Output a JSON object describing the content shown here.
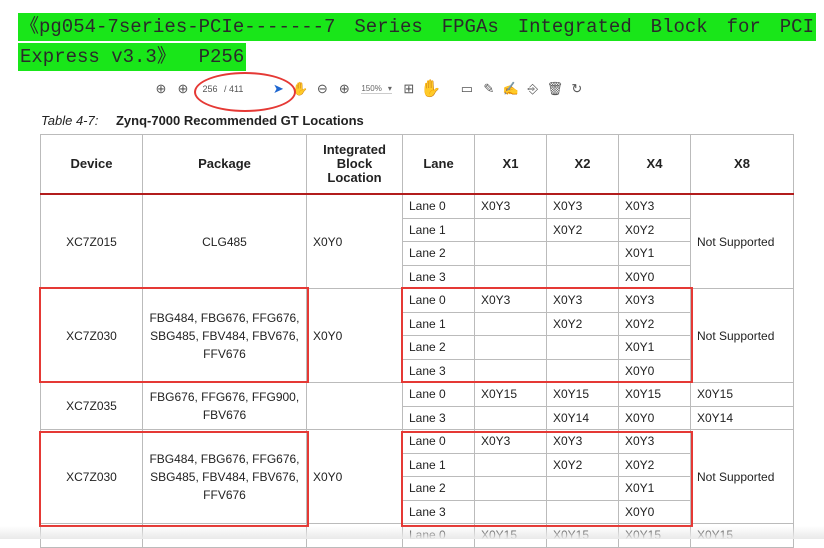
{
  "banner": {
    "line1_words": [
      "《pg054-7series-PCIe-------7",
      "Series",
      "FPGAs",
      "Integrated",
      "Block",
      "for",
      "PCI"
    ],
    "line2": "Express v3.3》  P256"
  },
  "toolbar": {
    "page_current": "256",
    "page_total": "/ 411",
    "zoom": "150%",
    "icons": [
      "up-arrow-icon",
      "down-arrow-icon",
      "cursor-icon",
      "hand-icon",
      "zoom-out-icon",
      "zoom-in-icon",
      "fit-page-icon",
      "hand-tool-icon",
      "comment-icon",
      "pen-icon",
      "sign-icon",
      "stamp-icon",
      "trash-icon",
      "redo-icon"
    ]
  },
  "caption": {
    "number": "Table 4-7:",
    "title": "Zynq-7000 Recommended GT Locations"
  },
  "table": {
    "headers": [
      "Device",
      "Package",
      "Integrated Block Location",
      "Lane",
      "X1",
      "X2",
      "X4",
      "X8"
    ],
    "groups": [
      {
        "device": "XC7Z015",
        "package": "CLG485",
        "location": "X0Y0",
        "x8": "Not Supported",
        "rows": [
          {
            "lane": "Lane 0",
            "x1": "X0Y3",
            "x2": "X0Y3",
            "x4": "X0Y3"
          },
          {
            "lane": "Lane 1",
            "x1": "",
            "x2": "X0Y2",
            "x4": "X0Y2"
          },
          {
            "lane": "Lane 2",
            "x1": "",
            "x2": "",
            "x4": "X0Y1"
          },
          {
            "lane": "Lane 3",
            "x1": "",
            "x2": "",
            "x4": "X0Y0"
          }
        ]
      },
      {
        "device": "XC7Z030",
        "package": "FBG484, FBG676, FFG676, SBG485, FBV484, FBV676, FFV676",
        "location": "X0Y0",
        "x8": "Not Supported",
        "rows": [
          {
            "lane": "Lane 0",
            "x1": "X0Y3",
            "x2": "X0Y3",
            "x4": "X0Y3"
          },
          {
            "lane": "Lane 1",
            "x1": "",
            "x2": "X0Y2",
            "x4": "X0Y2"
          },
          {
            "lane": "Lane 2",
            "x1": "",
            "x2": "",
            "x4": "X0Y1"
          },
          {
            "lane": "Lane 3",
            "x1": "",
            "x2": "",
            "x4": "X0Y0"
          }
        ]
      },
      {
        "device": "XC7Z035",
        "package": "FBG676, FFG676, FFG900, FBV676",
        "location": "",
        "rows": [
          {
            "lane": "Lane 0",
            "x1": "X0Y15",
            "x2": "X0Y15",
            "x4": "X0Y15",
            "x8": "X0Y15"
          },
          {
            "lane": "Lane 3",
            "x1": "",
            "x2": "X0Y14",
            "x4": "X0Y0",
            "x8": "X0Y14"
          }
        ]
      },
      {
        "device": "XC7Z030",
        "package": "FBG484, FBG676, FFG676, SBG485, FBV484, FBV676, FFV676",
        "location": "X0Y0",
        "x8": "Not Supported",
        "rows": [
          {
            "lane": "Lane 0",
            "x1": "X0Y3",
            "x2": "X0Y3",
            "x4": "X0Y3"
          },
          {
            "lane": "Lane 1",
            "x1": "",
            "x2": "X0Y2",
            "x4": "X0Y2"
          },
          {
            "lane": "Lane 2",
            "x1": "",
            "x2": "",
            "x4": "X0Y1"
          },
          {
            "lane": "Lane 3",
            "x1": "",
            "x2": "",
            "x4": "X0Y0"
          }
        ]
      },
      {
        "device": "",
        "package": "",
        "location": "",
        "rows": [
          {
            "lane": "Lane 0",
            "x1": "X0Y15",
            "x2": "X0Y15",
            "x4": "X0Y15",
            "x8": "X0Y15"
          }
        ]
      }
    ]
  },
  "colors": {
    "banner": "#19e619",
    "annotation": "#e53935",
    "header_rule": "#b21c1c"
  }
}
